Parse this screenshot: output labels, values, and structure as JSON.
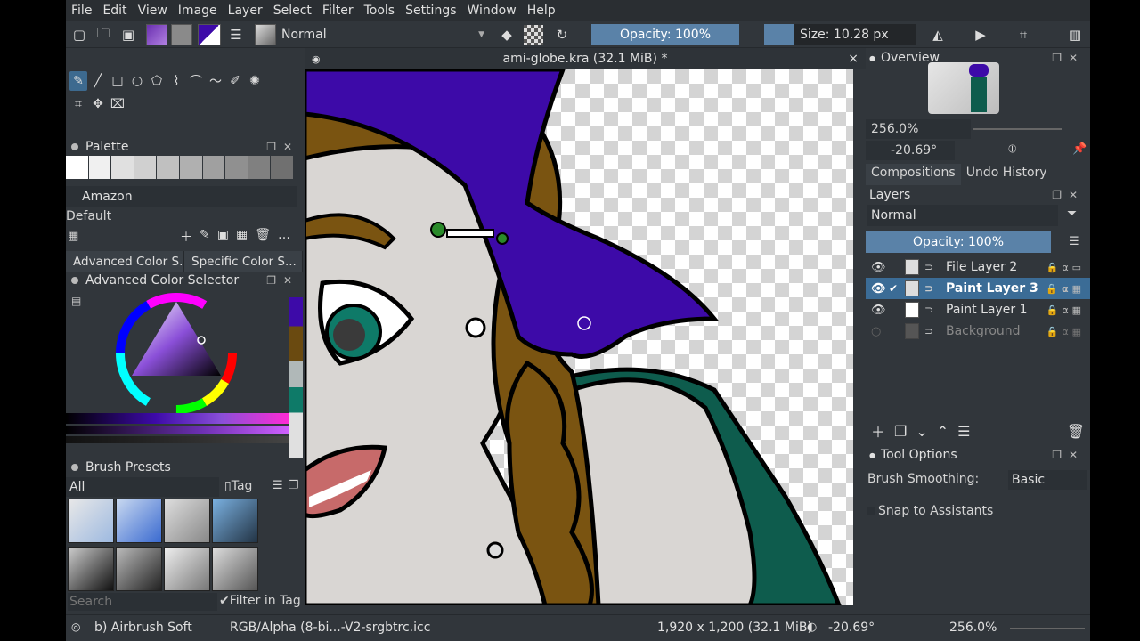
{
  "menu": [
    "File",
    "Edit",
    "View",
    "Image",
    "Layer",
    "Select",
    "Filter",
    "Tools",
    "Settings",
    "Window",
    "Help"
  ],
  "toolbar": {
    "blend_mode": "Normal",
    "opacity": "Opacity: 100%",
    "size": "Size: 10.28 px"
  },
  "document": {
    "tab_title": "ami-globe.kra (32.1 MiB) *",
    "close": "×"
  },
  "palette": {
    "title": "Palette",
    "palette_name": "Amazon",
    "group": "Default",
    "swatches": [
      "#ffffff",
      "#f0f0f0",
      "#e0e0e0",
      "#d0d0d0",
      "#c0c0c0",
      "#b0b0b0",
      "#a0a0a0",
      "#909090",
      "#808080",
      "#707070"
    ]
  },
  "color": {
    "tabs": [
      "Advanced Color S...",
      "Specific Color S..."
    ],
    "title": "Advanced Color Selector"
  },
  "brush_presets": {
    "title": "Brush Presets",
    "filter": "All",
    "tag": "Tag",
    "search_placeholder": "Search",
    "filter_in_tag": "Filter in Tag"
  },
  "overview": {
    "title": "Overview",
    "zoom": "256.0%",
    "rotation": "-20.69°"
  },
  "tabs_right": [
    "Compositions",
    "Undo History"
  ],
  "layers": {
    "title": "Layers",
    "blend_mode": "Normal",
    "opacity": "Opacity:  100%",
    "items": [
      {
        "name": "File Layer 2",
        "selected": false
      },
      {
        "name": "Paint Layer 3",
        "selected": true
      },
      {
        "name": "Paint Layer 1",
        "selected": false
      },
      {
        "name": "Background",
        "selected": false
      }
    ]
  },
  "tool_options": {
    "title": "Tool Options",
    "smoothing_label": "Brush Smoothing:",
    "smoothing_value": "Basic",
    "snap_label": "Snap to Assistants"
  },
  "status": {
    "brush": "b) Airbrush Soft",
    "color_profile": "RGB/Alpha (8-bi...-V2-srgbtrc.icc",
    "dimensions": "1,920 x 1,200 (32.1 MiB)",
    "rotation": "-20.69°",
    "zoom": "256.0%"
  },
  "colors": {
    "accent": "#3b6c96",
    "panel": "#31363b",
    "hat_purple": "#3d0aa8",
    "hair_brown": "#7a5411",
    "skin": "#d9d6d3",
    "eye_teal": "#0e7a68"
  }
}
